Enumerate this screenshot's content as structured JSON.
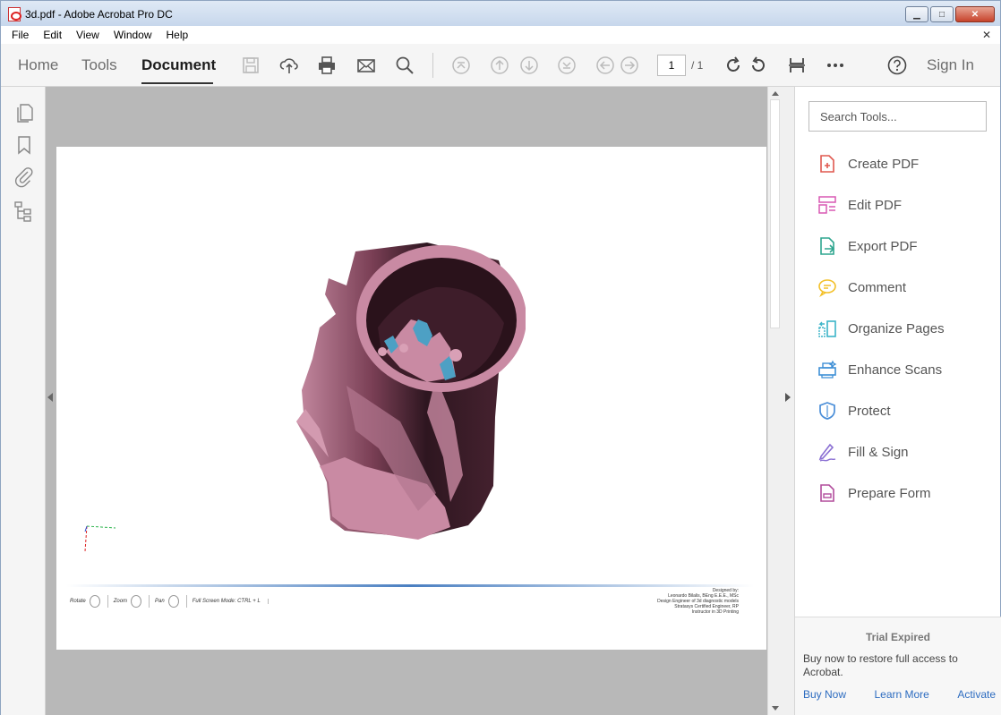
{
  "window": {
    "title": "3d.pdf - Adobe Acrobat Pro DC",
    "controls": {
      "minimize": "▁",
      "maximize": "□",
      "close": "✕"
    }
  },
  "menu": [
    "File",
    "Edit",
    "View",
    "Window",
    "Help"
  ],
  "menu_close": "✕",
  "toolbar": {
    "nav": {
      "home": "Home",
      "tools": "Tools",
      "document": "Document"
    },
    "page_current": "1",
    "page_total": "/ 1",
    "sign_in": "Sign In",
    "icons": [
      "save-icon",
      "upload-icon",
      "print-icon",
      "email-icon",
      "search-icon",
      "first-page-icon",
      "previous-page-icon",
      "next-page-icon",
      "last-page-icon",
      "back-icon",
      "forward-icon",
      "rotate-clockwise-icon",
      "rotate-counterclockwise-icon",
      "scroll-mode-icon",
      "more-icon",
      "help-icon"
    ]
  },
  "left_rail": [
    "page-thumbnails-icon",
    "bookmarks-icon",
    "attachments-icon",
    "layers-icon"
  ],
  "document": {
    "controls": [
      {
        "label": "Rotate"
      },
      {
        "label": "Zoom"
      },
      {
        "label": "Pan"
      }
    ],
    "fullscreen": "Full Screen Mode:  CTRL + L",
    "credits": [
      "Designed by:",
      "Leonardo Bilalis, BEng E.E.E., MSc",
      "Design Engineer of 3d diagnostic models",
      "Stratasys Certified Engineer, RP",
      "Instructor in 3D Printing"
    ]
  },
  "right_pane": {
    "search_placeholder": "Search Tools...",
    "tools": [
      {
        "label": "Create PDF",
        "color": "#e0584f"
      },
      {
        "label": "Edit PDF",
        "color": "#d859b3"
      },
      {
        "label": "Export PDF",
        "color": "#2fa68f"
      },
      {
        "label": "Comment",
        "color": "#f3c029"
      },
      {
        "label": "Organize Pages",
        "color": "#3bb4c8"
      },
      {
        "label": "Enhance Scans",
        "color": "#3e8fd6"
      },
      {
        "label": "Protect",
        "color": "#4a8ed8"
      },
      {
        "label": "Fill & Sign",
        "color": "#8a6fd3"
      },
      {
        "label": "Prepare Form",
        "color": "#b24d9c"
      }
    ],
    "trial": {
      "heading": "Trial Expired",
      "message": "Buy now to restore full access to Acrobat.",
      "buy": "Buy Now",
      "learn": "Learn More",
      "activate": "Activate"
    }
  },
  "colors": {
    "model_pink": "#c98aa3",
    "model_dark": "#3a1d27",
    "model_blue": "#4da0c4",
    "accent_link": "#2d6cc0"
  }
}
